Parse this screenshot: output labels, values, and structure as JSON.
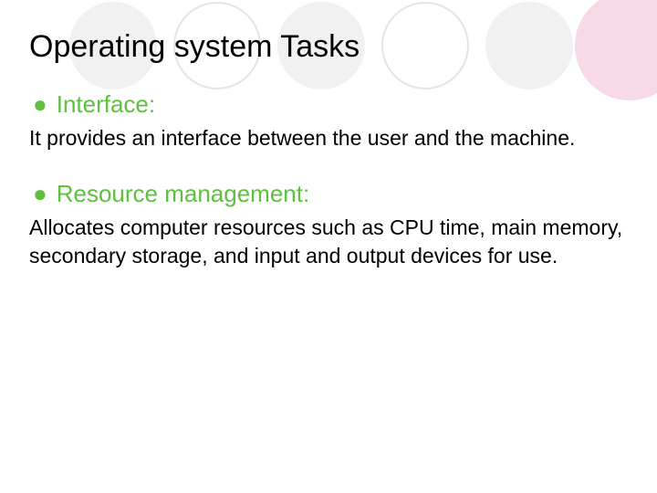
{
  "title": "Operating system Tasks",
  "bullets": [
    {
      "heading": "Interface:",
      "body": "It provides an interface between the user and the machine."
    },
    {
      "heading": "Resource management:",
      "body": "Allocates computer resources such as CPU time, main memory, secondary storage, and input and output devices for use."
    }
  ],
  "colors": {
    "accent": "#5fbf3f",
    "circleFill": "#f1f1f1",
    "circleStroke": "#e4e4e4",
    "pink": "#f7d9e8"
  }
}
